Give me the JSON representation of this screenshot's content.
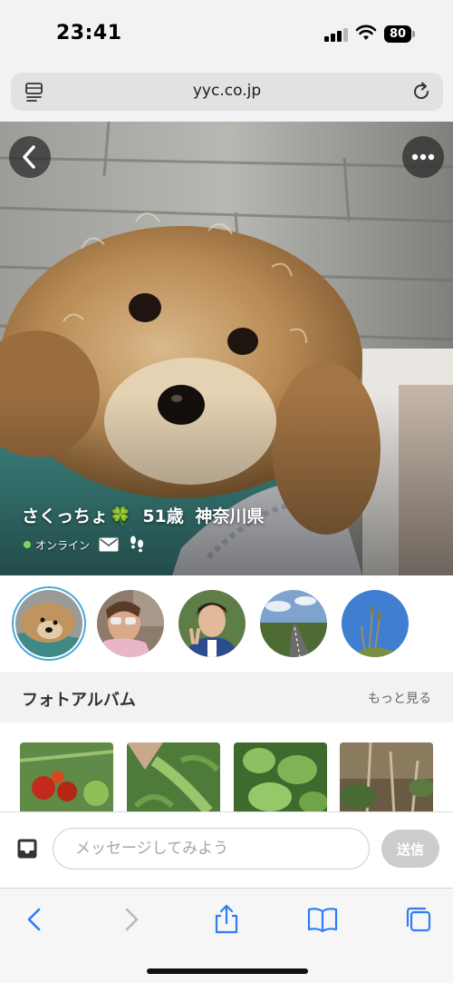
{
  "status_bar": {
    "time": "23:41",
    "battery": "80"
  },
  "browser": {
    "url": "yyc.co.jp"
  },
  "profile": {
    "name": "さくっちょ",
    "name_emoji": "🍀",
    "age": "51歳",
    "location": "神奈川県",
    "online_label": "オンライン"
  },
  "thumbnails": [
    {
      "subject": "dog",
      "selected": true
    },
    {
      "subject": "person-sunglasses",
      "selected": false
    },
    {
      "subject": "person-peace-sign",
      "selected": false
    },
    {
      "subject": "road-landscape",
      "selected": false
    },
    {
      "subject": "sky-plants",
      "selected": false
    }
  ],
  "album": {
    "title": "フォトアルバム",
    "more_label": "もっと見る",
    "photos": [
      "tomatoes",
      "goya",
      "leafy-plant",
      "garden"
    ]
  },
  "message": {
    "placeholder": "メッセージしてみよう",
    "send_label": "送信"
  },
  "colors": {
    "accent": "#4aa8d8",
    "online": "#7ed957",
    "ios_blue": "#2f7cf6",
    "send_disabled": "#cccccc"
  },
  "icons": [
    "reader-icon",
    "reload-icon",
    "back-chevron-icon",
    "more-dots-icon",
    "mail-icon",
    "footprint-icon",
    "inbox-icon",
    "safari-back-icon",
    "safari-forward-icon",
    "share-icon",
    "bookmarks-icon",
    "tabs-icon"
  ]
}
